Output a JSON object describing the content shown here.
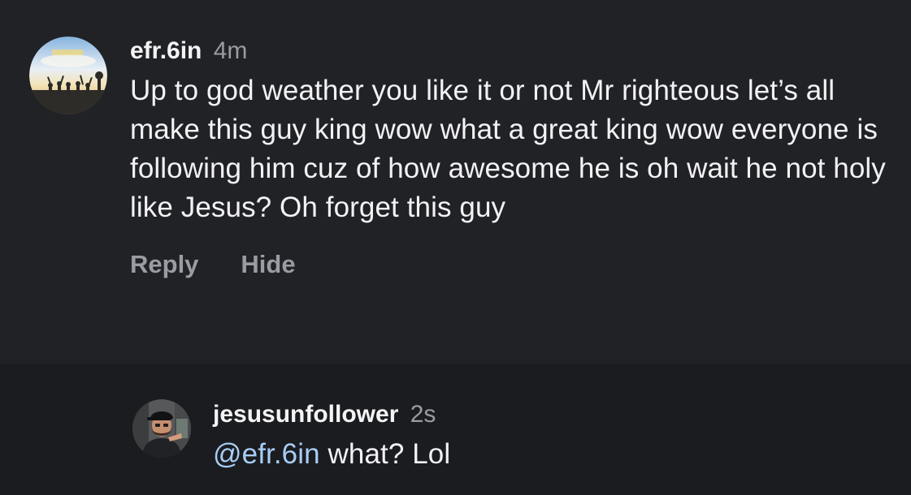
{
  "comment": {
    "username": "efr.6in",
    "time": "4m",
    "text": "Up to god weather you like it or not Mr righteous let’s all make this guy king wow what a great king wow everyone is following him cuz of how awesome he is oh wait he not holy like Jesus? Oh forget this guy",
    "actions": {
      "reply": "Reply",
      "hide": "Hide"
    }
  },
  "reply": {
    "username": "jesusunfollower",
    "time": "2s",
    "mention": "@efr.6in",
    "text": " what? Lol"
  },
  "colors": {
    "background": "#212226",
    "reply_background": "#1b1c20",
    "text": "#f2f2f5",
    "muted": "#9b9ca3",
    "mention": "#a7cdf5"
  },
  "icons": {
    "comment_avatar": "sky-silhouette-avatar",
    "reply_avatar": "man-cap-avatar"
  }
}
